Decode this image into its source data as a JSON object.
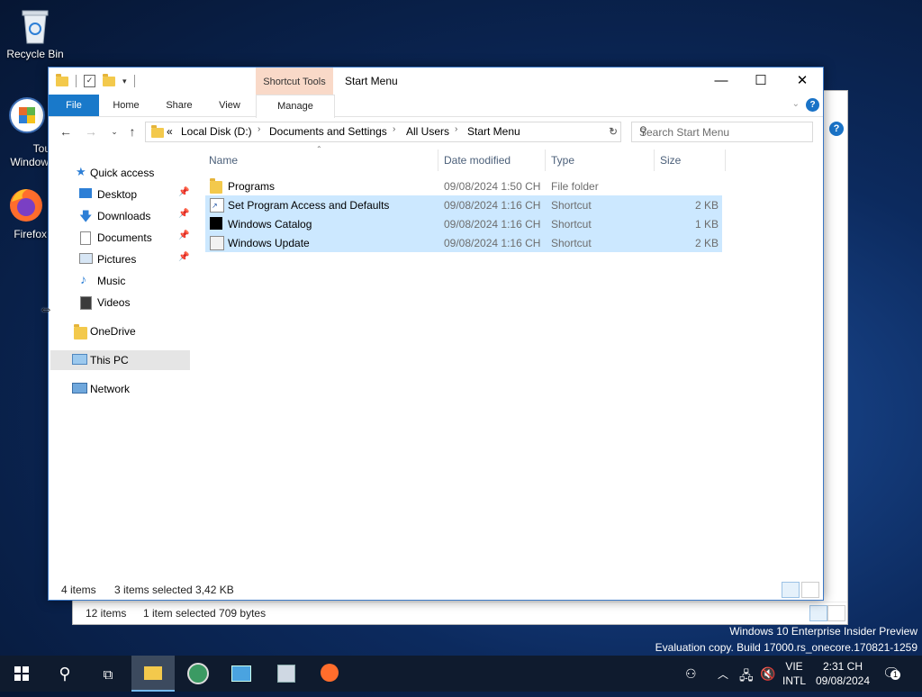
{
  "desktop": {
    "icons": [
      {
        "label": "Recycle Bin"
      },
      {
        "label": "Tour Windows"
      },
      {
        "label": "Firefox"
      }
    ],
    "watermark_line1": "Windows 10 Enterprise Insider Preview",
    "watermark_line2": "Evaluation copy. Build 17000.rs_onecore.170821-1259"
  },
  "back_window": {
    "status_items": "12 items",
    "status_selected": "1 item selected  709 bytes"
  },
  "window": {
    "title": "Start Menu",
    "contextual_group": "Shortcut Tools",
    "ribbon_tabs": [
      "File",
      "Home",
      "Share",
      "View",
      "Manage"
    ],
    "help_label": "?",
    "controls": {
      "minimize": "—",
      "maximize": "☐",
      "close": "✕"
    },
    "address": {
      "overflow": "«",
      "crumbs": [
        "Local Disk (D:)",
        "Documents and Settings",
        "All Users",
        "Start Menu"
      ],
      "crumb_sep": "›"
    },
    "search_placeholder": "Search Start Menu",
    "nav": [
      {
        "label": "Quick access",
        "pinned": false
      },
      {
        "label": "Desktop",
        "pinned": true
      },
      {
        "label": "Downloads",
        "pinned": true
      },
      {
        "label": "Documents",
        "pinned": true
      },
      {
        "label": "Pictures",
        "pinned": true
      },
      {
        "label": "Music",
        "pinned": false
      },
      {
        "label": "Videos",
        "pinned": false
      },
      {
        "label": "OneDrive",
        "pinned": false
      },
      {
        "label": "This PC",
        "pinned": false,
        "selected": true
      },
      {
        "label": "Network",
        "pinned": false
      }
    ],
    "columns": [
      "Name",
      "Date modified",
      "Type",
      "Size"
    ],
    "files": [
      {
        "name": "Programs",
        "date": "09/08/2024 1:50 CH",
        "type": "File folder",
        "size": "",
        "selected": false,
        "icon": "folder-icon"
      },
      {
        "name": "Set Program Access and Defaults",
        "date": "09/08/2024 1:16 CH",
        "type": "Shortcut",
        "size": "2 KB",
        "selected": true,
        "icon": "shortcut-icon"
      },
      {
        "name": "Windows Catalog",
        "date": "09/08/2024 1:16 CH",
        "type": "Shortcut",
        "size": "1 KB",
        "selected": true,
        "icon": "catalog-shortcut-icon"
      },
      {
        "name": "Windows Update",
        "date": "09/08/2024 1:16 CH",
        "type": "Shortcut",
        "size": "2 KB",
        "selected": true,
        "icon": "update-shortcut-icon"
      }
    ],
    "status_items": "4 items",
    "status_selected": "3 items selected  3,42 KB"
  },
  "taskbar": {
    "language": [
      "VIE",
      "INTL"
    ],
    "time": "2:31 CH",
    "date": "09/08/2024",
    "notification_count": "1"
  }
}
